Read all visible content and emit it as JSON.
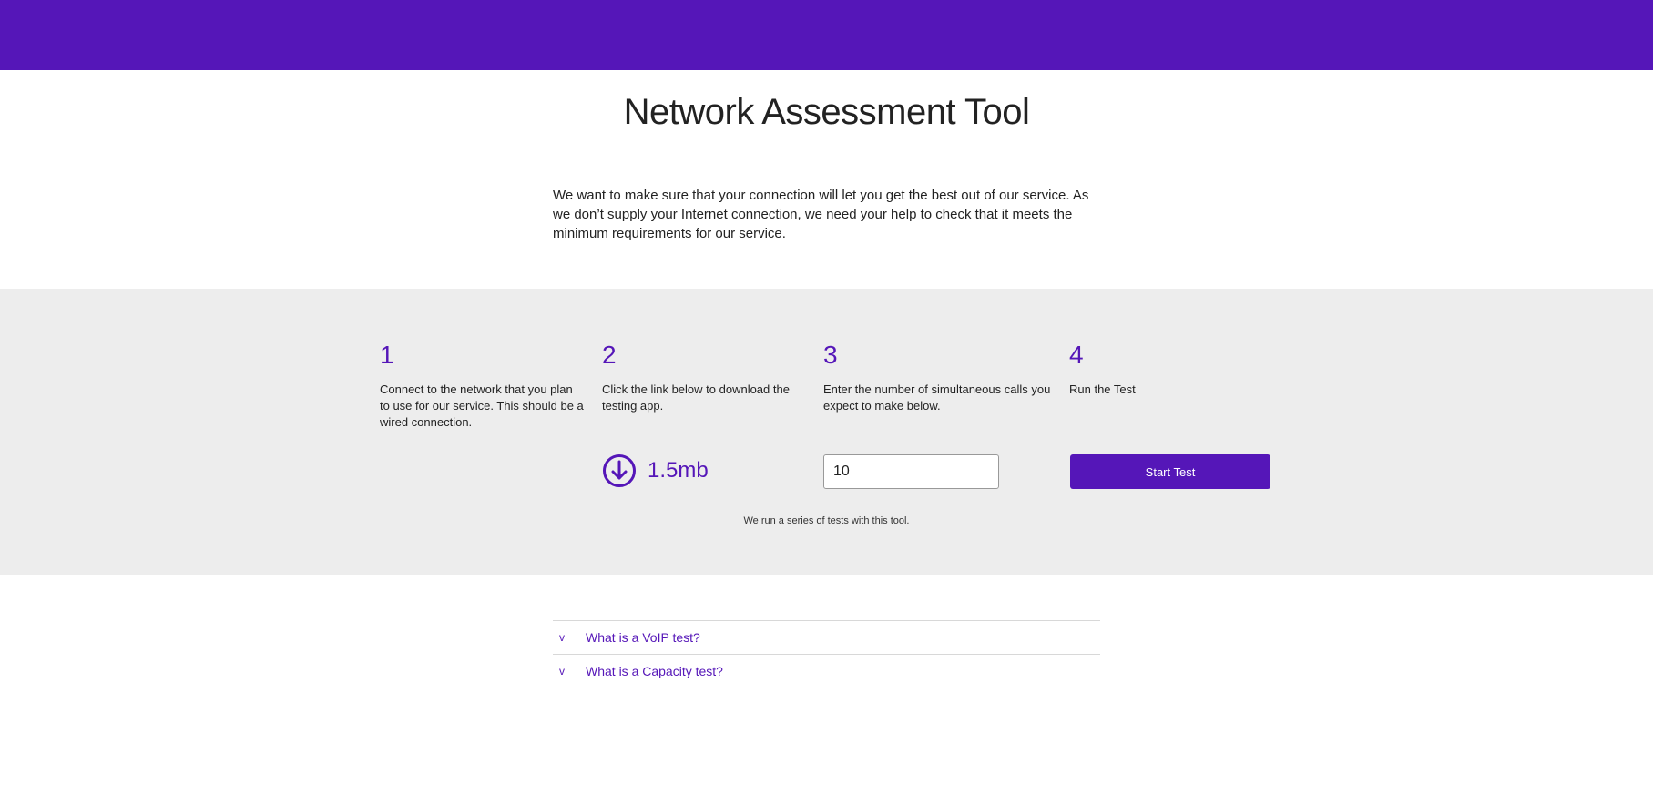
{
  "colors": {
    "brand": "#5516b8",
    "band": "#ededed"
  },
  "header": {
    "title": "Network Assessment Tool"
  },
  "intro": "We want to make sure that your connection will let you get the best out of our service. As we don’t supply your Internet connection, we need your help to check that it meets the minimum requirements for our service.",
  "steps": [
    {
      "number": "1",
      "text": "Connect to the network that you plan to use for our service. This should be a wired connection."
    },
    {
      "number": "2",
      "text": "Click the link below to download the testing app."
    },
    {
      "number": "3",
      "text": "Enter the number of simultaneous calls you expect to make below."
    },
    {
      "number": "4",
      "text": "Run the Test"
    }
  ],
  "download": {
    "icon": "download-circle-icon",
    "size_label": "1.5mb"
  },
  "calls_input": {
    "value": "10"
  },
  "start_button": {
    "label": "Start Test"
  },
  "tests_note": "We run a series of tests with this tool.",
  "faq": [
    {
      "chevron": "v",
      "label": "What is a VoIP test?"
    },
    {
      "chevron": "v",
      "label": "What is a Capacity test?"
    }
  ]
}
